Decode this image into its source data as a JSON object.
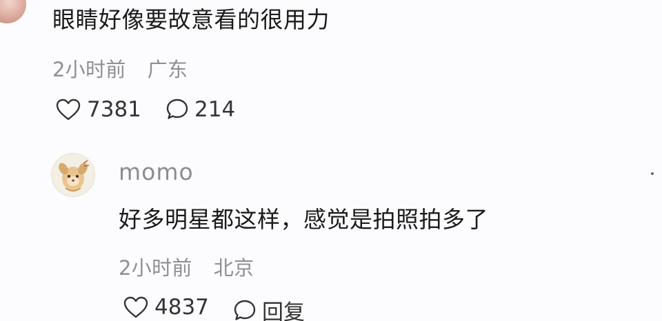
{
  "comment": {
    "text": "眼睛好像要故意看的很用力",
    "time": "2小时前",
    "location": "广东",
    "likes": "7381",
    "replies": "214"
  },
  "reply": {
    "username": "momo",
    "text": "好多明星都这样，感觉是拍照拍多了",
    "time": "2小时前",
    "location": "北京",
    "likes": "4837",
    "reply_label": "回复"
  },
  "icons": {
    "like": "heart-icon",
    "comment": "speech-bubble-icon",
    "more": "more-dot-icon"
  }
}
